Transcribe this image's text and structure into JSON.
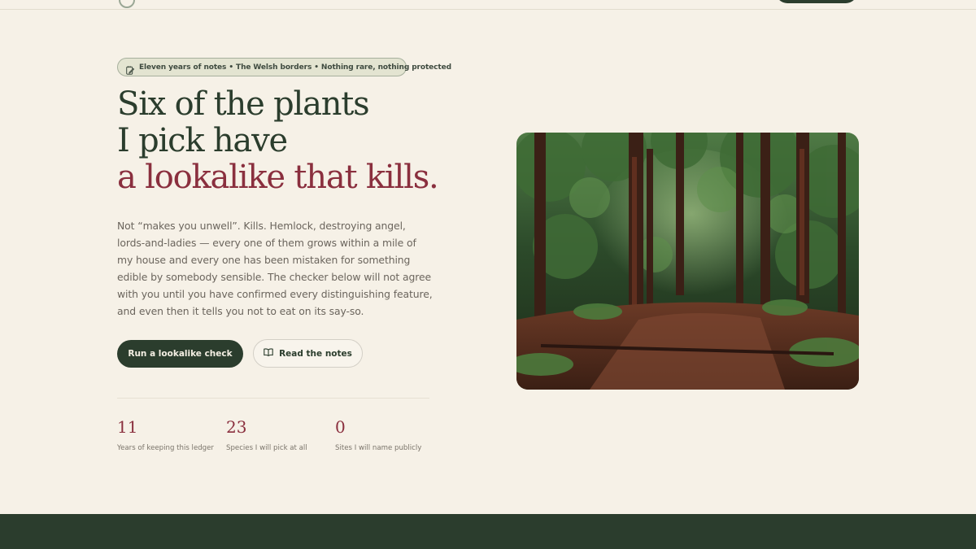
{
  "hero": {
    "eyebrow": "Eleven years of notes • The Welsh borders • Nothing rare, nothing protected",
    "headline_line1": "Six of the plants",
    "headline_line2": "I pick have",
    "headline_accent": "a lookalike that kills.",
    "lede": "Not “makes you unwell”. Kills. Hemlock, destroying angel, lords-and-ladies — every one of them grows within a mile of my house and every one has been mistaken for something edible by somebody sensible. The checker below will not agree with you until you have confirmed every distinguishing feature, and even then it tells you not to eat on its say-so.",
    "primary_cta": "Run a lookalike check",
    "secondary_cta": "Read the notes",
    "icons": {
      "eyebrow": "notebook-pen-icon",
      "secondary_cta": "book-open-icon"
    }
  },
  "stats": [
    {
      "value": "11",
      "label": "Years of keeping this ledger"
    },
    {
      "value": "23",
      "label": "Species I will pick at all"
    },
    {
      "value": "0",
      "label": "Sites I will name publicly"
    }
  ],
  "colors": {
    "background": "#f6f1e7",
    "forest_green": "#2b3d2d",
    "accent_red": "#8a2f3e",
    "body_text": "#6b655d"
  },
  "image": {
    "subject": "forest path through tall trees"
  }
}
